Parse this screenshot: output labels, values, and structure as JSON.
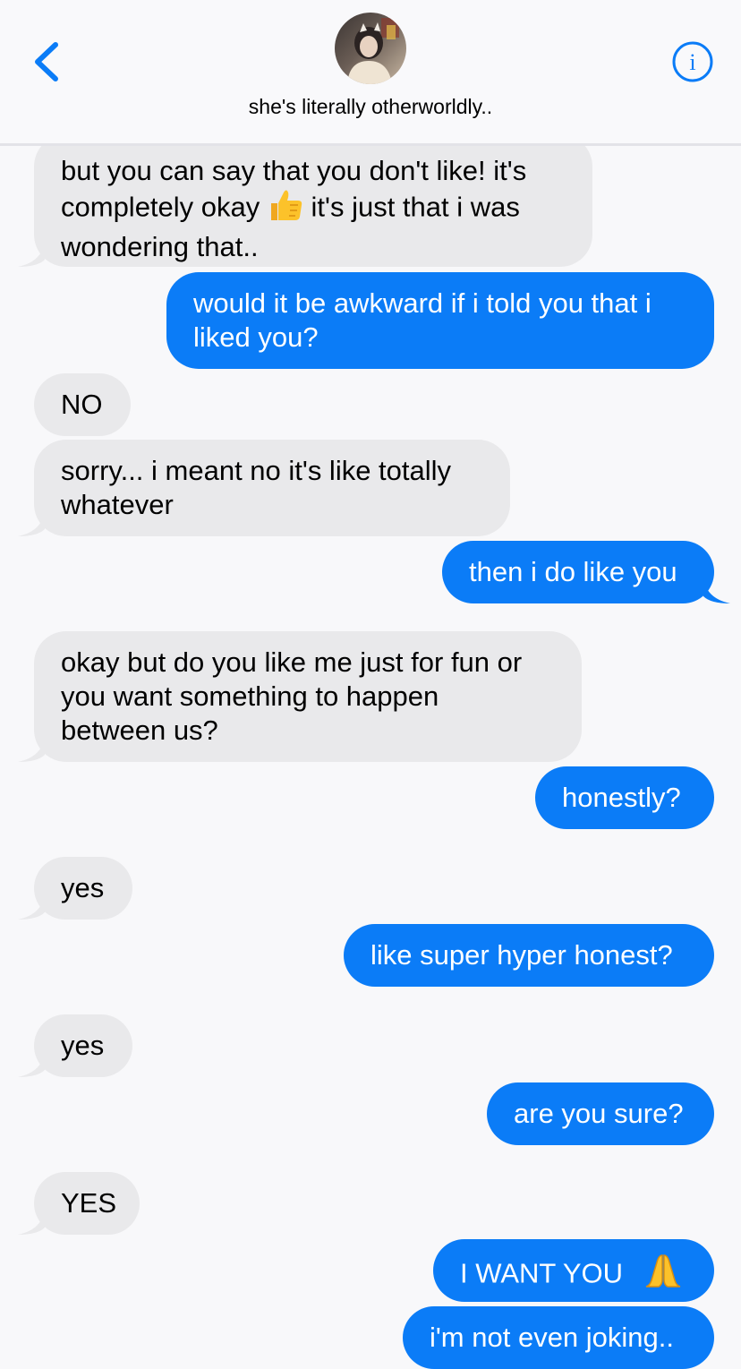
{
  "header": {
    "contact_name": "she's literally otherworldly..",
    "back_icon": "chevron-left-icon",
    "info_icon": "info-circle-icon",
    "info_glyph": "i"
  },
  "colors": {
    "sent_bubble": "#0b7cf7",
    "received_bubble": "#e9e9eb",
    "accent": "#0b7cf7"
  },
  "messages": [
    {
      "from": "them",
      "lines": [
        "but you can say that you don't like! it's",
        "completely okay [thumbs-up] it's just that i was",
        "wondering that.."
      ]
    },
    {
      "from": "me",
      "lines": [
        "would it be awkward if i told you that i",
        "liked you?"
      ]
    },
    {
      "from": "them",
      "lines": [
        "NO"
      ]
    },
    {
      "from": "them",
      "lines": [
        "sorry... i meant no it's like totally",
        "whatever"
      ]
    },
    {
      "from": "me",
      "lines": [
        "then i do like you"
      ]
    },
    {
      "from": "them",
      "lines": [
        "okay but do you like me just for fun or",
        "you want something to happen",
        "between us?"
      ]
    },
    {
      "from": "me",
      "lines": [
        "honestly?"
      ]
    },
    {
      "from": "them",
      "lines": [
        "yes"
      ]
    },
    {
      "from": "me",
      "lines": [
        "like super hyper honest?"
      ]
    },
    {
      "from": "them",
      "lines": [
        "yes"
      ]
    },
    {
      "from": "me",
      "lines": [
        "are you sure?"
      ]
    },
    {
      "from": "them",
      "lines": [
        "YES"
      ]
    },
    {
      "from": "me",
      "lines": [
        "I WANT YOU [folded-hands]"
      ]
    },
    {
      "from": "me",
      "lines": [
        "i'm not even joking.."
      ]
    }
  ],
  "text": {
    "m1_l1": "but you can say that you don't like! it's",
    "m1_l2a": "completely okay",
    "m1_l2b": "it's just that i was",
    "m1_l3": "wondering that..",
    "m2_l1": "would it be awkward if i told you that i",
    "m2_l2": "liked you?",
    "m3": "NO",
    "m4_l1": "sorry... i meant no it's like totally",
    "m4_l2": "whatever",
    "m5": "then i do like you",
    "m6_l1": "okay but do you like me just for fun or",
    "m6_l2": "you want something to happen",
    "m6_l3": "between us?",
    "m7": "honestly?",
    "m8": "yes",
    "m9": "like super hyper honest?",
    "m10": "yes",
    "m11": "are you sure?",
    "m12": "YES",
    "m13": "I WANT YOU",
    "m14": "i'm not even joking.."
  },
  "emojis": {
    "thumbs_up": "thumbs-up-icon",
    "folded_hands": "folded-hands-icon"
  }
}
